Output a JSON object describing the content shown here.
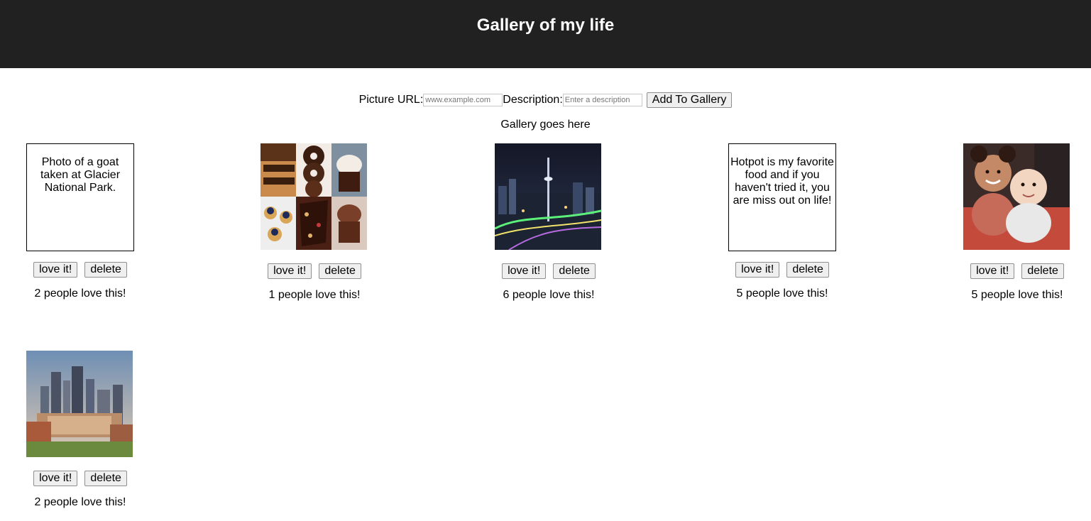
{
  "header": {
    "title": "Gallery of my life"
  },
  "form": {
    "url_label": "Picture URL:",
    "url_placeholder": "www.example.com",
    "desc_label": "Description:",
    "desc_placeholder": "Enter a description",
    "submit_label": "Add To Gallery"
  },
  "gallery_label": "Gallery goes here",
  "items": [
    {
      "kind": "text",
      "description": "Photo of a goat taken at Glacier National Park.",
      "love_label": "love it!",
      "delete_label": "delete",
      "count_text": "2 people love this!"
    },
    {
      "kind": "image",
      "image": "desserts-collage-image",
      "love_label": "love it!",
      "delete_label": "delete",
      "count_text": "1 people love this!"
    },
    {
      "kind": "image",
      "image": "night-city-tower-image",
      "love_label": "love it!",
      "delete_label": "delete",
      "count_text": "6 people love this!"
    },
    {
      "kind": "text",
      "description": "Hotpot is my favorite food and if you haven't tried it, you are miss out on life!",
      "love_label": "love it!",
      "delete_label": "delete",
      "count_text": "5 people love this!"
    },
    {
      "kind": "image",
      "image": "children-photo-image",
      "love_label": "love it!",
      "delete_label": "delete",
      "count_text": "5 people love this!"
    },
    {
      "kind": "image",
      "image": "city-skyline-image",
      "love_label": "love it!",
      "delete_label": "delete",
      "count_text": "2 people love this!"
    }
  ],
  "colors": {
    "header_bg": "#212121",
    "header_text": "#ffffff",
    "button_bg": "#efefef"
  }
}
